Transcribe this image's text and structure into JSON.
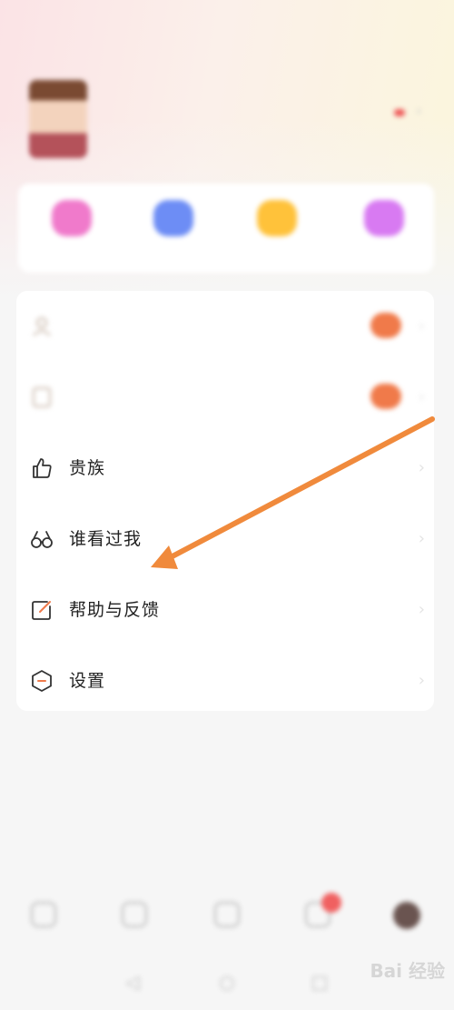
{
  "status_bar": {
    "left": "",
    "right": ""
  },
  "profile": {
    "username": "",
    "subtitle": ""
  },
  "quick_actions": [
    {
      "label": "",
      "color": "#f07acb"
    },
    {
      "label": "",
      "color": "#6d8df5"
    },
    {
      "label": "",
      "color": "#ffc23a"
    },
    {
      "label": "",
      "color": "#d87af2"
    }
  ],
  "menu": [
    {
      "label": "",
      "value": "",
      "icon": "portrait-icon",
      "blurred": true
    },
    {
      "label": "",
      "value": "",
      "icon": "note-icon",
      "blurred": true
    },
    {
      "label": "贵族",
      "icon": "thumb-up-icon"
    },
    {
      "label": "谁看过我",
      "icon": "glasses-icon"
    },
    {
      "label": "帮助与反馈",
      "icon": "edit-icon"
    },
    {
      "label": "设置",
      "icon": "hexagon-minus-icon"
    }
  ],
  "tabbar": [
    {
      "label": "",
      "icon": "home-icon"
    },
    {
      "label": "",
      "icon": "chat-icon"
    },
    {
      "label": "",
      "icon": "video-icon"
    },
    {
      "label": "",
      "icon": "message-icon",
      "badge": true
    },
    {
      "label": "",
      "icon": "avatar-icon"
    }
  ],
  "watermark": "Bai 经验",
  "colors": {
    "arrow": "#f08a3c",
    "accent": "#f07a4a",
    "text": "#222222"
  }
}
